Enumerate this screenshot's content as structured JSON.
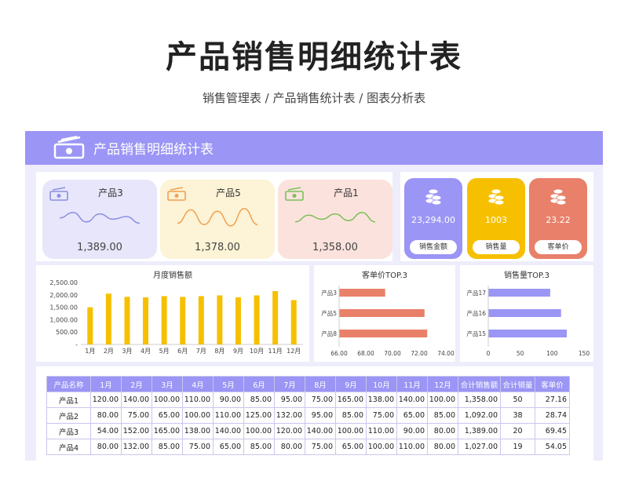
{
  "page": {
    "title": "产品销售明细统计表",
    "subtitle": "销售管理表 / 产品销售统计表 / 图表分析表"
  },
  "banner": {
    "title": "产品销售明细统计表"
  },
  "colors": {
    "accent": "#9b95f5",
    "yellow": "#f6c000",
    "orange": "#e8806a",
    "lavender_bg": "#eeedfb"
  },
  "trend_cards": [
    {
      "name": "产品3",
      "value": "1,389.00",
      "bg": "#e8e6fb",
      "line": "#8a8fe0",
      "icon": "money-icon",
      "points": [
        0.55,
        0.35,
        0.7,
        0.4,
        0.6,
        0.5,
        0.75
      ]
    },
    {
      "name": "产品5",
      "value": "1,378.00",
      "bg": "#fdf3d6",
      "line": "#f0a050",
      "icon": "money-icon",
      "points": [
        0.75,
        0.25,
        0.8,
        0.3,
        0.85,
        0.2,
        0.8
      ]
    },
    {
      "name": "产品1",
      "value": "1,358.00",
      "bg": "#fbe2dc",
      "line": "#7bbf5a",
      "icon": "money-icon",
      "points": [
        0.7,
        0.45,
        0.6,
        0.4,
        0.65,
        0.35,
        0.7
      ]
    }
  ],
  "kpis": [
    {
      "value": "23,294.00",
      "label": "销售金额",
      "bg": "#9b95f5",
      "icon": "coins-icon"
    },
    {
      "value": "1003",
      "label": "销售量",
      "bg": "#f6c000",
      "icon": "coins-icon"
    },
    {
      "value": "23.22",
      "label": "客单价",
      "bg": "#e8806a",
      "icon": "coins-icon"
    }
  ],
  "chart_data": [
    {
      "type": "bar",
      "title": "月度销售额",
      "categories": [
        "1月",
        "2月",
        "3月",
        "4月",
        "5月",
        "6月",
        "7月",
        "8月",
        "9月",
        "10月",
        "11月",
        "12月"
      ],
      "values": [
        1500,
        2050,
        1920,
        1900,
        1950,
        1920,
        1950,
        1980,
        1900,
        1980,
        2150,
        1790
      ],
      "ylim": [
        0,
        2500
      ],
      "yticks": [
        "2,500.00",
        "2,000.00",
        "1,500.00",
        "1,000.00",
        "500.00",
        "-"
      ],
      "color": "#f6c000"
    },
    {
      "type": "bar",
      "orientation": "horizontal",
      "title": "客单价TOP.3",
      "categories": [
        "产品3",
        "产品5",
        "产品8"
      ],
      "values": [
        69.45,
        72.4,
        72.6
      ],
      "xlim": [
        66,
        74
      ],
      "xticks": [
        "66.00",
        "68.00",
        "70.00",
        "72.00",
        "74.00"
      ],
      "color": "#e8806a"
    },
    {
      "type": "bar",
      "orientation": "horizontal",
      "title": "销售量TOP.3",
      "categories": [
        "产品17",
        "产品16",
        "产品15"
      ],
      "values": [
        97,
        114,
        123
      ],
      "xlim": [
        0,
        150
      ],
      "xticks": [
        "0",
        "50",
        "100",
        "150"
      ],
      "color": "#9b95f5"
    }
  ],
  "table": {
    "headers": [
      "产品名称",
      "1月",
      "2月",
      "3月",
      "4月",
      "5月",
      "6月",
      "7月",
      "8月",
      "9月",
      "10月",
      "11月",
      "12月",
      "合计销售额",
      "合计销量",
      "客单价"
    ],
    "rows": [
      [
        "产品1",
        "120.00",
        "140.00",
        "100.00",
        "110.00",
        "90.00",
        "85.00",
        "95.00",
        "75.00",
        "165.00",
        "138.00",
        "140.00",
        "100.00",
        "1,358.00",
        "50",
        "27.16"
      ],
      [
        "产品2",
        "80.00",
        "75.00",
        "65.00",
        "100.00",
        "110.00",
        "125.00",
        "132.00",
        "95.00",
        "85.00",
        "75.00",
        "65.00",
        "85.00",
        "1,092.00",
        "38",
        "28.74"
      ],
      [
        "产品3",
        "54.00",
        "152.00",
        "165.00",
        "138.00",
        "140.00",
        "100.00",
        "120.00",
        "140.00",
        "100.00",
        "110.00",
        "90.00",
        "80.00",
        "1,389.00",
        "20",
        "69.45"
      ],
      [
        "产品4",
        "80.00",
        "132.00",
        "85.00",
        "75.00",
        "65.00",
        "85.00",
        "80.00",
        "75.00",
        "65.00",
        "100.00",
        "110.00",
        "80.00",
        "1,027.00",
        "19",
        "54.05"
      ]
    ]
  }
}
